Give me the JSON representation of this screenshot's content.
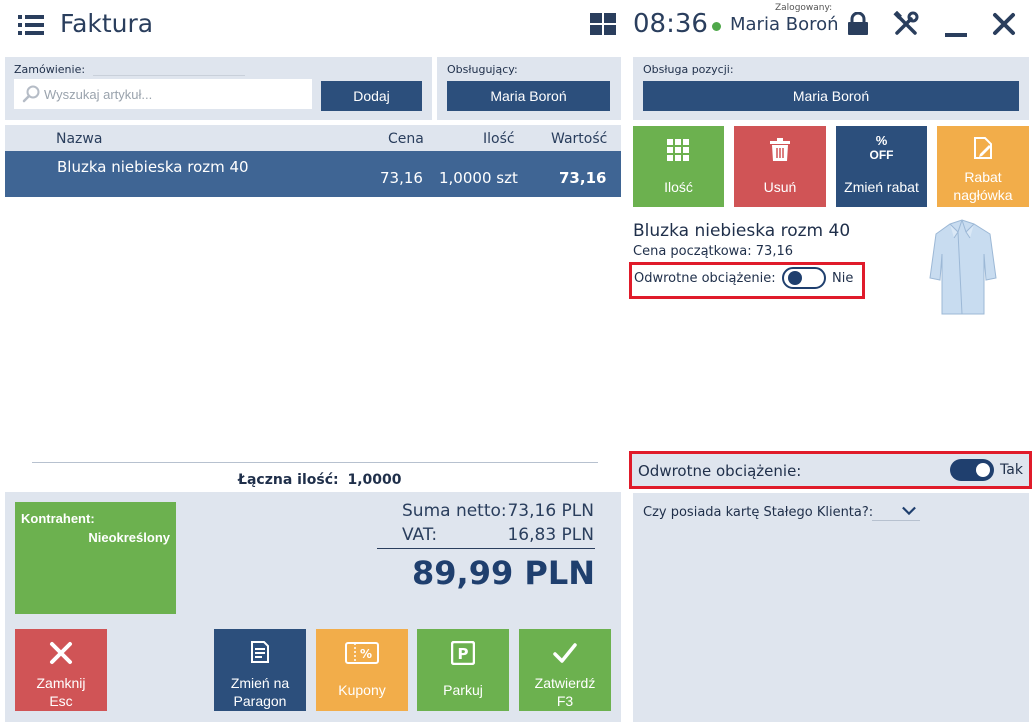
{
  "header": {
    "title": "Faktura",
    "time": "08:36",
    "logged_label": "Zalogowany:",
    "user": "Maria Boroń"
  },
  "order": {
    "label": "Zamówienie:",
    "search_placeholder": "Wyszukaj artykuł...",
    "add_button": "Dodaj"
  },
  "operator": {
    "label": "Obsługujący:",
    "name": "Maria Boroń"
  },
  "table": {
    "columns": {
      "name": "Nazwa",
      "price": "Cena",
      "qty": "Ilość",
      "value": "Wartość"
    },
    "rows": [
      {
        "name": "Bluzka niebieska rozm 40",
        "price": "73,16",
        "qty": "1,0000 szt",
        "value": "73,16"
      }
    ],
    "total_qty_label": "Łączna ilość:",
    "total_qty_value": "1,0000"
  },
  "customer": {
    "label": "Kontrahent:",
    "value": "Nieokreślony"
  },
  "totals": {
    "net_label": "Suma netto:",
    "net_value": "73,16 PLN",
    "vat_label": "VAT:",
    "vat_value": "16,83 PLN",
    "gross": "89,99 PLN"
  },
  "bottom_buttons": {
    "close": "Zamknij",
    "close_key": "Esc",
    "to_receipt_1": "Zmień na",
    "to_receipt_2": "Paragon",
    "coupons": "Kupony",
    "park": "Parkuj",
    "confirm": "Zatwierdź",
    "confirm_key": "F3"
  },
  "position": {
    "label": "Obsługa pozycji:",
    "operator": "Maria Boroń",
    "tiles": {
      "qty": "Ilość",
      "delete": "Usuń",
      "discount": "Zmień rabat",
      "discount_icon_top": "%",
      "discount_icon_bottom": "OFF",
      "header_discount_1": "Rabat",
      "header_discount_2": "nagłówka"
    },
    "item_name": "Bluzka niebieska rozm 40",
    "initial_price": "Cena początkowa: 73,16",
    "reverse_charge_label": "Odwrotne obciążenie:",
    "reverse_charge_value": "Nie"
  },
  "document": {
    "reverse_charge_label": "Odwrotne obciążenie:",
    "reverse_charge_value": "Tak",
    "loyalty_question": "Czy posiada kartę Stałego Klienta?:"
  },
  "colors": {
    "green": "#6cb14f",
    "red": "#d05456",
    "navy": "#2c4f7c",
    "orange": "#f2ad4a"
  }
}
